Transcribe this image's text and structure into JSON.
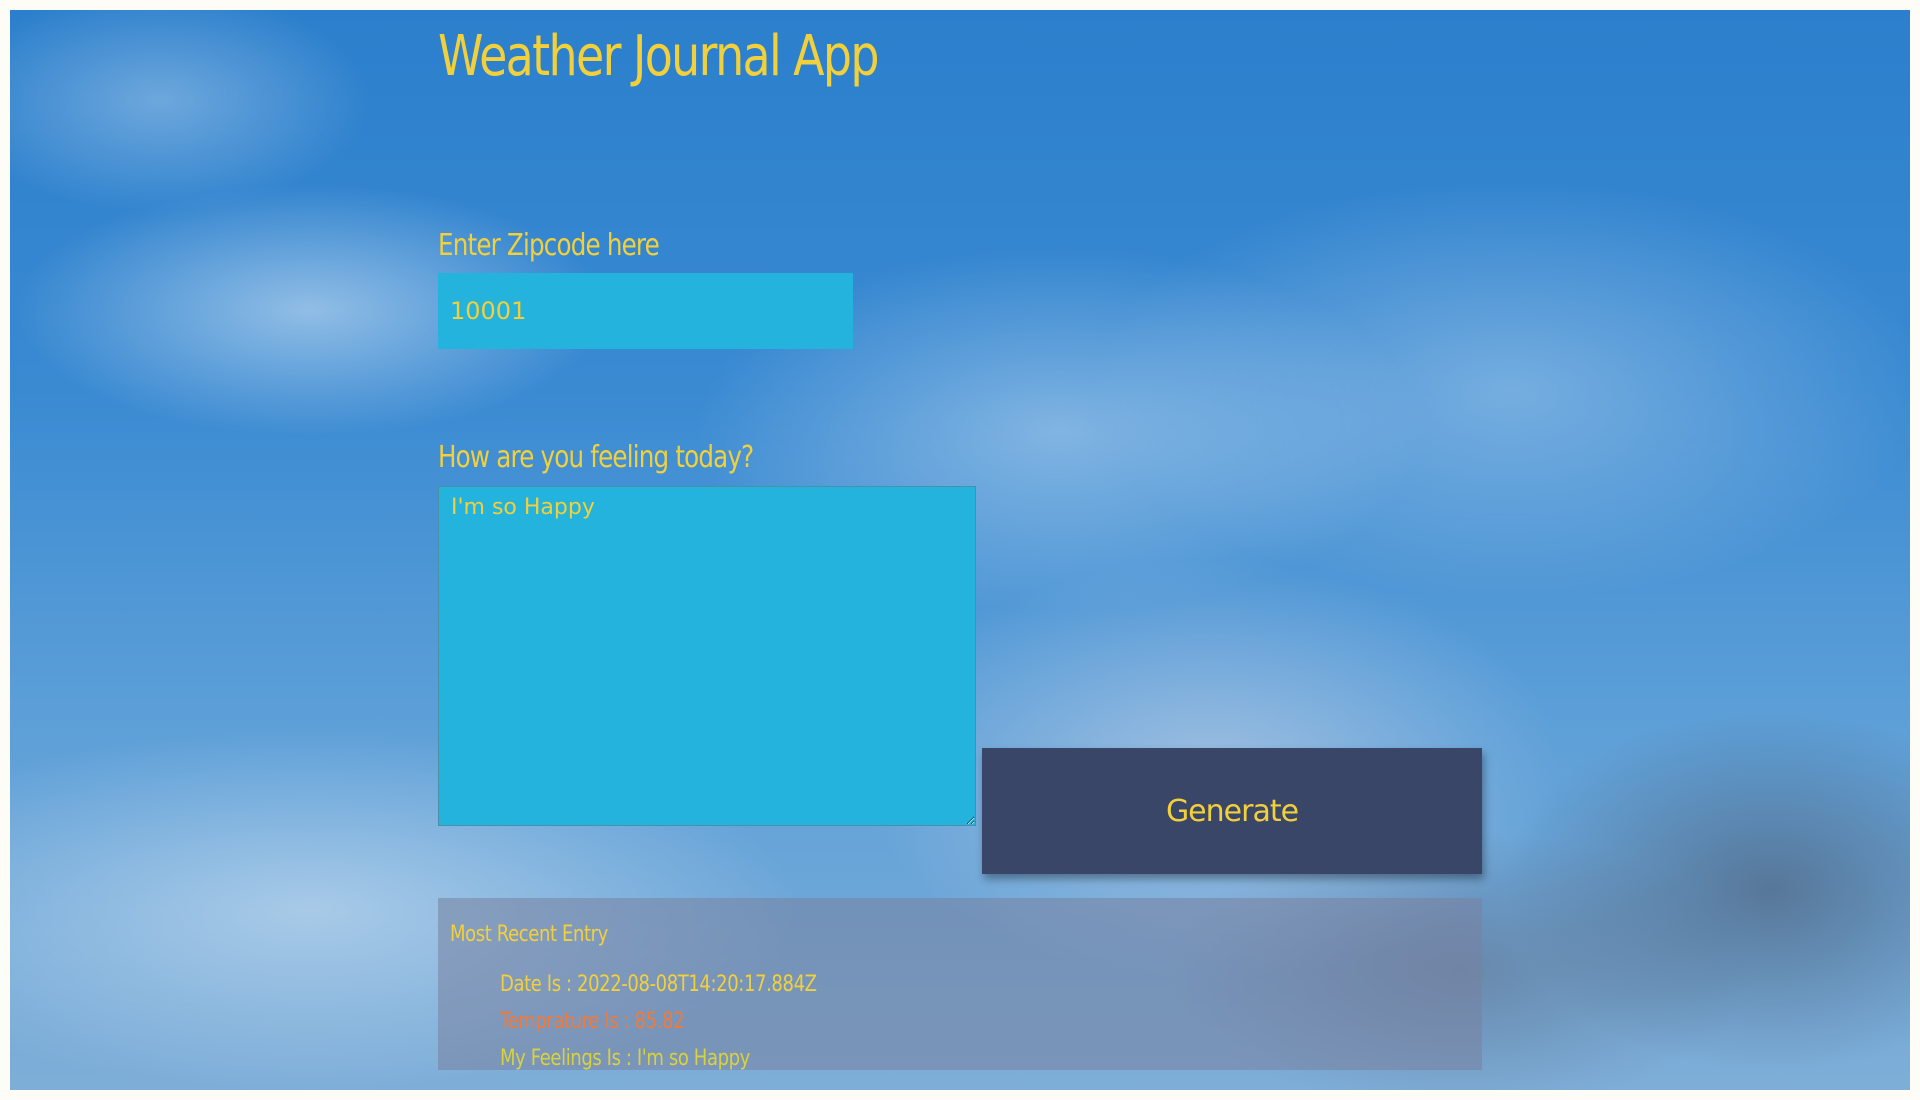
{
  "app": {
    "title": "Weather Journal App"
  },
  "zip": {
    "label": "Enter Zipcode here",
    "value": "10001"
  },
  "feelings": {
    "label": "How are you feeling today?",
    "value": "I'm so Happy"
  },
  "generate_button": {
    "label": "Generate"
  },
  "entry": {
    "title": "Most Recent Entry",
    "date": "Date Is : 2022-08-08T14:20:17.884Z",
    "temp": "Temprature Is : 85.82",
    "feelings": "My Feelings Is : I'm so Happy"
  },
  "colors": {
    "accent_text": "#f2d03b",
    "temperature_text": "#f07a3a",
    "feelings_text": "#d8d23c",
    "input_background": "#23b3dc",
    "button_background": "#3a4667"
  }
}
